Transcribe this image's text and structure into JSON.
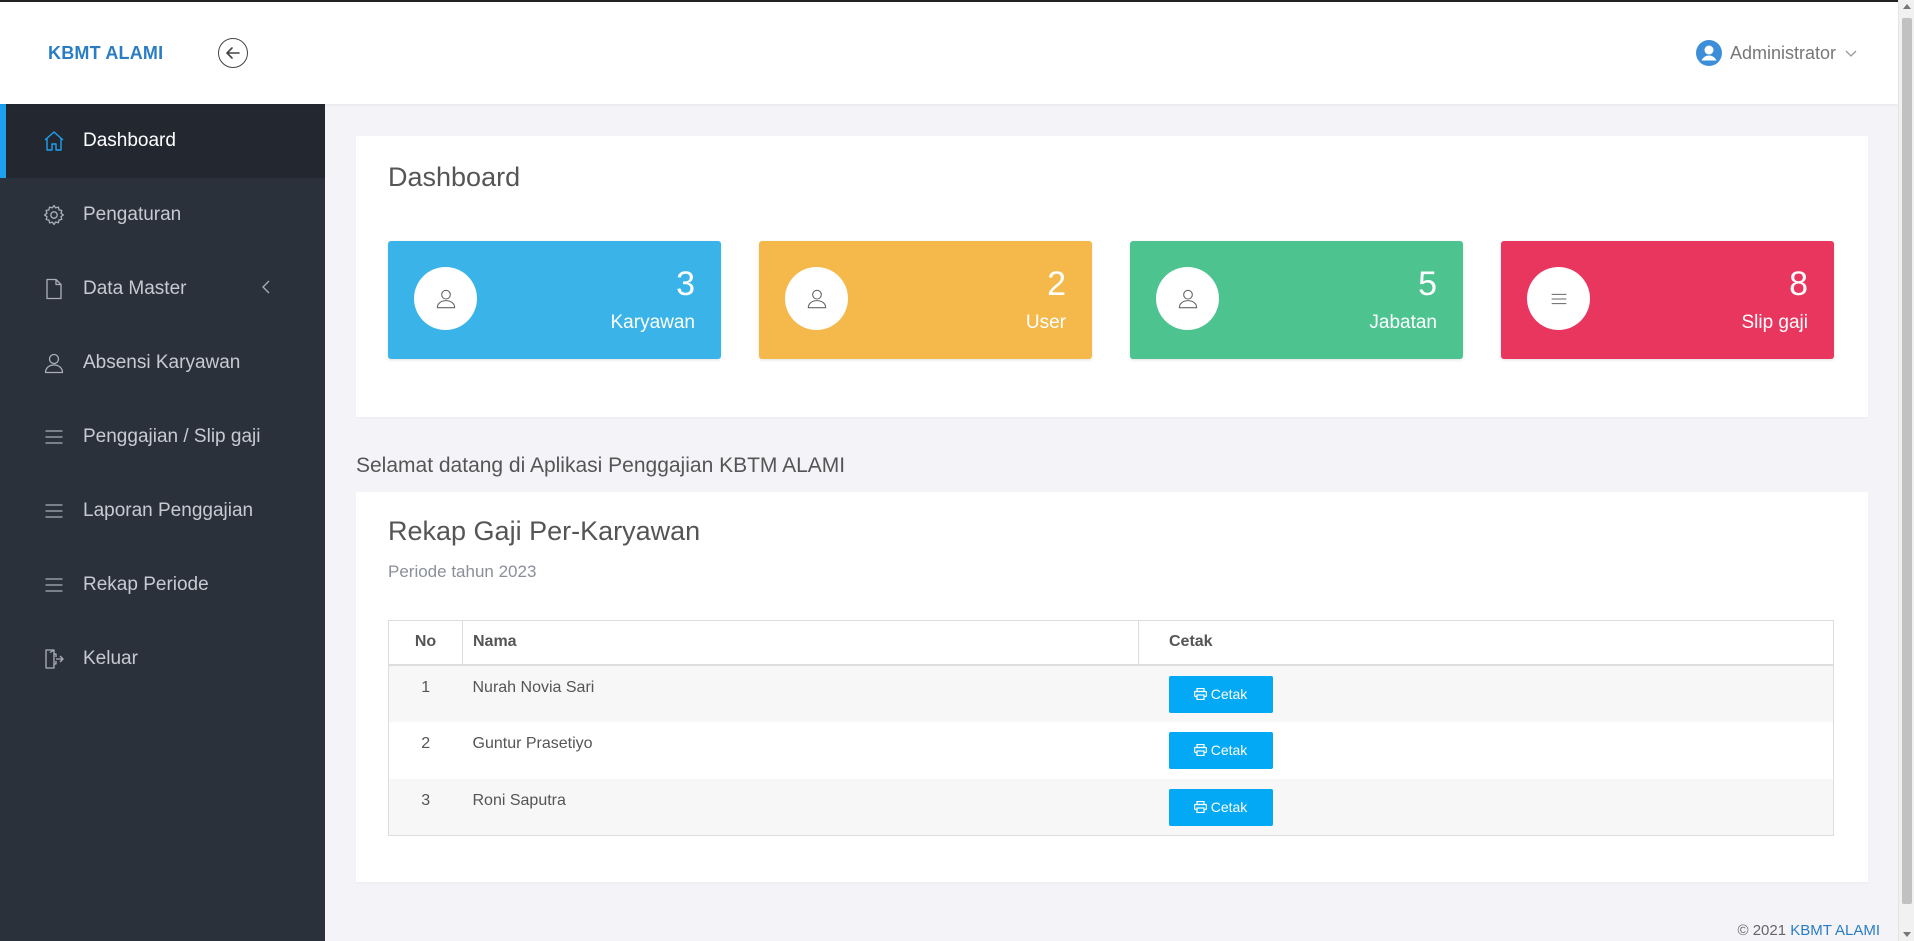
{
  "header": {
    "brand": "KBMT ALAMI",
    "user": "Administrator"
  },
  "sidebar": {
    "items": [
      {
        "label": "Dashboard",
        "icon": "home-icon",
        "active": true
      },
      {
        "label": "Pengaturan",
        "icon": "gear-icon"
      },
      {
        "label": "Data Master",
        "icon": "file-icon",
        "has_submenu": true
      },
      {
        "label": "Absensi Karyawan",
        "icon": "user-icon"
      },
      {
        "label": "Penggajian / Slip gaji",
        "icon": "menu-icon"
      },
      {
        "label": "Laporan Penggajian",
        "icon": "menu-icon"
      },
      {
        "label": "Rekap Periode",
        "icon": "menu-icon"
      },
      {
        "label": "Keluar",
        "icon": "logout-icon"
      }
    ]
  },
  "dashboard": {
    "title": "Dashboard",
    "stats": [
      {
        "value": "3",
        "label": "Karyawan",
        "color": "#3ab4e8",
        "icon": "user-icon"
      },
      {
        "value": "2",
        "label": "User",
        "color": "#f5b94b",
        "icon": "user-icon"
      },
      {
        "value": "5",
        "label": "Jabatan",
        "color": "#4dc390",
        "icon": "user-icon"
      },
      {
        "value": "8",
        "label": "Slip gaji",
        "color": "#e8365f",
        "icon": "menu-icon"
      }
    ]
  },
  "welcome": "Selamat datang di Aplikasi Penggajian KBTM ALAMI",
  "rekap": {
    "title": "Rekap Gaji Per-Karyawan",
    "subtitle": "Periode tahun 2023",
    "columns": [
      "No",
      "Nama",
      "Cetak"
    ],
    "rows": [
      {
        "no": "1",
        "nama": "Nurah Novia Sari",
        "action": "Cetak"
      },
      {
        "no": "2",
        "nama": "Guntur Prasetiyo",
        "action": "Cetak"
      },
      {
        "no": "3",
        "nama": "Roni Saputra",
        "action": "Cetak"
      }
    ]
  },
  "footer": {
    "copyright": "© 2021",
    "link": "KBMT ALAMI"
  },
  "colors": {
    "accent": "#1ea0f0",
    "sidebar_bg": "#2b313b",
    "button": "#03a9f4"
  }
}
